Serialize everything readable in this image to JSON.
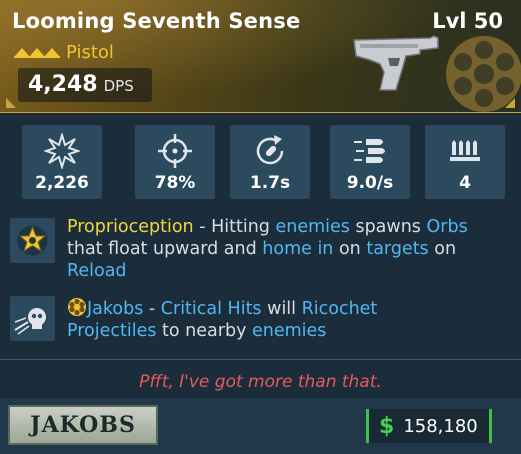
{
  "item": {
    "name": "Looming Seventh Sense",
    "level": "Lvl 50",
    "weapon_type": "Pistol",
    "dps_value": "4,248",
    "dps_unit": "DPS"
  },
  "stats": [
    {
      "icon": "damage-burst-icon",
      "value": "2,226"
    },
    {
      "icon": "accuracy-crosshair-icon",
      "value": "78%"
    },
    {
      "icon": "reload-time-icon",
      "value": "1.7s"
    },
    {
      "icon": "fire-rate-bullets-icon",
      "value": "9.0/s"
    },
    {
      "icon": "magazine-size-icon",
      "value": "4"
    }
  ],
  "perks": {
    "primary": {
      "name": "Proprioception",
      "sep": " - Hitting ",
      "w1": "enemies",
      "t1": " spawns ",
      "w2": "Orbs",
      "line2_a": "that float upward and ",
      "w3": "home in",
      "t2": " on ",
      "w4": "targets",
      "t3": " on",
      "w5": "Reload"
    },
    "manufacturer": {
      "name": "Jakobs",
      "sep": " - ",
      "w1": "Critical Hits",
      "t1": " will ",
      "w2": "Ricochet",
      "w3": "Projectiles",
      "t2": " to nearby ",
      "w4": "enemies"
    }
  },
  "flavor_text": "Pfft, I've got more than that.",
  "footer": {
    "manufacturer_logo": "JAKOBS",
    "currency_symbol": "$",
    "price": "158,180"
  },
  "colors": {
    "legendary_gold": "#f2c530",
    "keyword_blue": "#51b7f2",
    "flavor_red": "#e45b5b",
    "money_green": "#3ec246",
    "panel_bg": "#1b2d3b",
    "stat_bg": "#2b4a5e"
  }
}
